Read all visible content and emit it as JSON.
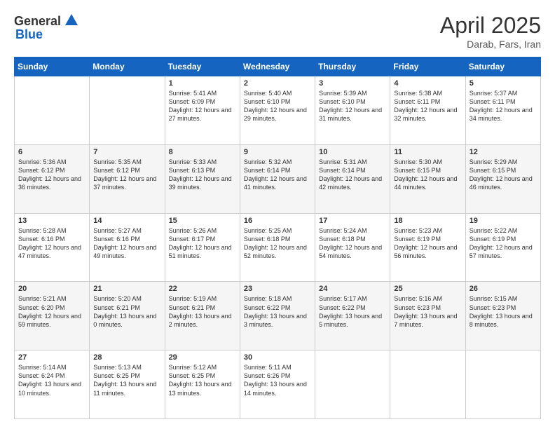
{
  "header": {
    "logo_general": "General",
    "logo_blue": "Blue",
    "title": "April 2025",
    "location": "Darab, Fars, Iran"
  },
  "weekdays": [
    "Sunday",
    "Monday",
    "Tuesday",
    "Wednesday",
    "Thursday",
    "Friday",
    "Saturday"
  ],
  "weeks": [
    [
      {
        "day": "",
        "info": ""
      },
      {
        "day": "",
        "info": ""
      },
      {
        "day": "1",
        "info": "Sunrise: 5:41 AM\nSunset: 6:09 PM\nDaylight: 12 hours and 27 minutes."
      },
      {
        "day": "2",
        "info": "Sunrise: 5:40 AM\nSunset: 6:10 PM\nDaylight: 12 hours and 29 minutes."
      },
      {
        "day": "3",
        "info": "Sunrise: 5:39 AM\nSunset: 6:10 PM\nDaylight: 12 hours and 31 minutes."
      },
      {
        "day": "4",
        "info": "Sunrise: 5:38 AM\nSunset: 6:11 PM\nDaylight: 12 hours and 32 minutes."
      },
      {
        "day": "5",
        "info": "Sunrise: 5:37 AM\nSunset: 6:11 PM\nDaylight: 12 hours and 34 minutes."
      }
    ],
    [
      {
        "day": "6",
        "info": "Sunrise: 5:36 AM\nSunset: 6:12 PM\nDaylight: 12 hours and 36 minutes."
      },
      {
        "day": "7",
        "info": "Sunrise: 5:35 AM\nSunset: 6:12 PM\nDaylight: 12 hours and 37 minutes."
      },
      {
        "day": "8",
        "info": "Sunrise: 5:33 AM\nSunset: 6:13 PM\nDaylight: 12 hours and 39 minutes."
      },
      {
        "day": "9",
        "info": "Sunrise: 5:32 AM\nSunset: 6:14 PM\nDaylight: 12 hours and 41 minutes."
      },
      {
        "day": "10",
        "info": "Sunrise: 5:31 AM\nSunset: 6:14 PM\nDaylight: 12 hours and 42 minutes."
      },
      {
        "day": "11",
        "info": "Sunrise: 5:30 AM\nSunset: 6:15 PM\nDaylight: 12 hours and 44 minutes."
      },
      {
        "day": "12",
        "info": "Sunrise: 5:29 AM\nSunset: 6:15 PM\nDaylight: 12 hours and 46 minutes."
      }
    ],
    [
      {
        "day": "13",
        "info": "Sunrise: 5:28 AM\nSunset: 6:16 PM\nDaylight: 12 hours and 47 minutes."
      },
      {
        "day": "14",
        "info": "Sunrise: 5:27 AM\nSunset: 6:16 PM\nDaylight: 12 hours and 49 minutes."
      },
      {
        "day": "15",
        "info": "Sunrise: 5:26 AM\nSunset: 6:17 PM\nDaylight: 12 hours and 51 minutes."
      },
      {
        "day": "16",
        "info": "Sunrise: 5:25 AM\nSunset: 6:18 PM\nDaylight: 12 hours and 52 minutes."
      },
      {
        "day": "17",
        "info": "Sunrise: 5:24 AM\nSunset: 6:18 PM\nDaylight: 12 hours and 54 minutes."
      },
      {
        "day": "18",
        "info": "Sunrise: 5:23 AM\nSunset: 6:19 PM\nDaylight: 12 hours and 56 minutes."
      },
      {
        "day": "19",
        "info": "Sunrise: 5:22 AM\nSunset: 6:19 PM\nDaylight: 12 hours and 57 minutes."
      }
    ],
    [
      {
        "day": "20",
        "info": "Sunrise: 5:21 AM\nSunset: 6:20 PM\nDaylight: 12 hours and 59 minutes."
      },
      {
        "day": "21",
        "info": "Sunrise: 5:20 AM\nSunset: 6:21 PM\nDaylight: 13 hours and 0 minutes."
      },
      {
        "day": "22",
        "info": "Sunrise: 5:19 AM\nSunset: 6:21 PM\nDaylight: 13 hours and 2 minutes."
      },
      {
        "day": "23",
        "info": "Sunrise: 5:18 AM\nSunset: 6:22 PM\nDaylight: 13 hours and 3 minutes."
      },
      {
        "day": "24",
        "info": "Sunrise: 5:17 AM\nSunset: 6:22 PM\nDaylight: 13 hours and 5 minutes."
      },
      {
        "day": "25",
        "info": "Sunrise: 5:16 AM\nSunset: 6:23 PM\nDaylight: 13 hours and 7 minutes."
      },
      {
        "day": "26",
        "info": "Sunrise: 5:15 AM\nSunset: 6:23 PM\nDaylight: 13 hours and 8 minutes."
      }
    ],
    [
      {
        "day": "27",
        "info": "Sunrise: 5:14 AM\nSunset: 6:24 PM\nDaylight: 13 hours and 10 minutes."
      },
      {
        "day": "28",
        "info": "Sunrise: 5:13 AM\nSunset: 6:25 PM\nDaylight: 13 hours and 11 minutes."
      },
      {
        "day": "29",
        "info": "Sunrise: 5:12 AM\nSunset: 6:25 PM\nDaylight: 13 hours and 13 minutes."
      },
      {
        "day": "30",
        "info": "Sunrise: 5:11 AM\nSunset: 6:26 PM\nDaylight: 13 hours and 14 minutes."
      },
      {
        "day": "",
        "info": ""
      },
      {
        "day": "",
        "info": ""
      },
      {
        "day": "",
        "info": ""
      }
    ]
  ]
}
